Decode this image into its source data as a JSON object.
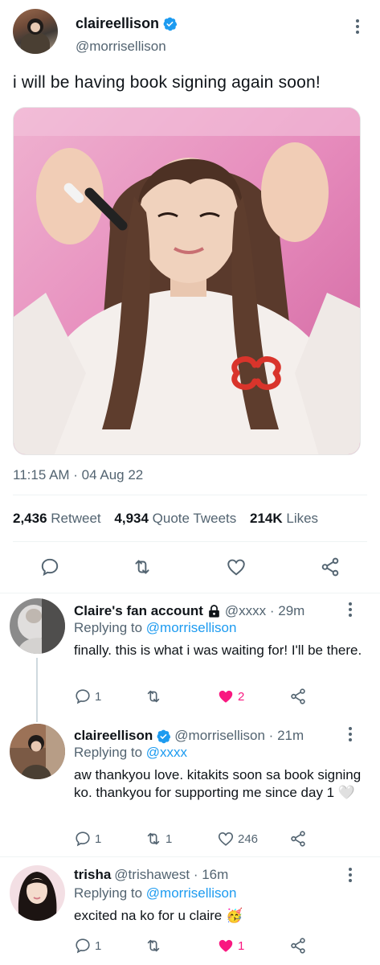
{
  "main_tweet": {
    "display_name": "claireellison",
    "handle": "@morrisellison",
    "text": "i will be having book signing again soon!",
    "timestamp": "11:15 AM · 04 Aug 22",
    "stats": {
      "retweets_count": "2,436",
      "retweets_label": "Retweet",
      "quotes_count": "4,934",
      "quotes_label": "Quote Tweets",
      "likes_count": "214K",
      "likes_label": "Likes"
    },
    "image_icon": "photo"
  },
  "replies": [
    {
      "display_name": "Claire's fan account",
      "locked_icon": "lock-icon",
      "handle": "@xxxx",
      "time": "29m",
      "replying_label": "Replying to",
      "replying_to": "@morrisellison",
      "text": "finally. this is what i was waiting for! I'll be there.",
      "reply_count": "1",
      "retweet_count": "",
      "like_count": "2",
      "liked": true
    },
    {
      "display_name": "claireellison",
      "verified": true,
      "handle": "@morrisellison",
      "time": "21m",
      "replying_label": "Replying to",
      "replying_to": "@xxxx",
      "text": "aw thankyou love. kitakits soon sa book signing ko. thankyou for supporting me since day 1 🤍",
      "reply_count": "1",
      "retweet_count": "1",
      "like_count": "246",
      "liked": false
    },
    {
      "display_name": "trisha",
      "handle": "@trishawest",
      "time": "16m",
      "replying_label": "Replying to",
      "replying_to": "@morrisellison",
      "text": "excited na ko for u claire 🥳",
      "reply_count": "1",
      "retweet_count": "",
      "like_count": "1",
      "liked": true
    }
  ],
  "colors": {
    "accent": "#1d9bf0",
    "like": "#f91880",
    "muted": "#536471",
    "text": "#0f1419"
  }
}
